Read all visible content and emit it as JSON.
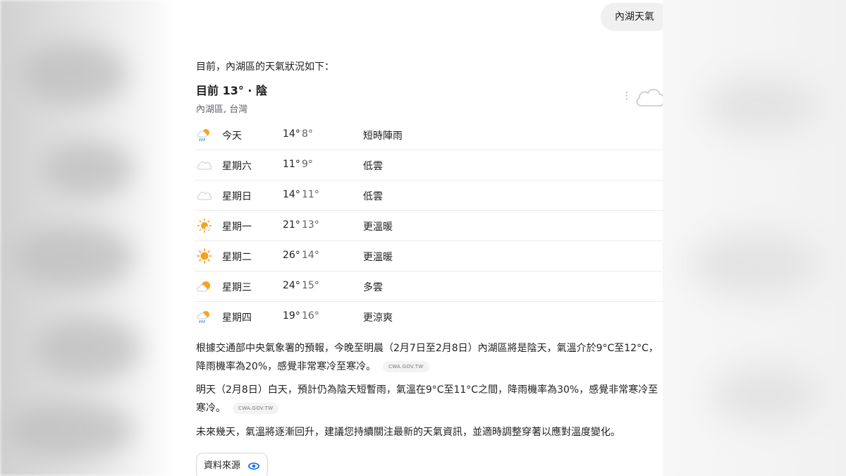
{
  "query": "內湖天氣",
  "intro": "目前，內湖區的天氣狀況如下：",
  "current": {
    "title": "目前 13° · 陰",
    "location": "內湖區, 台灣",
    "icon": "cloud-icon"
  },
  "forecast": [
    {
      "day": "今天",
      "hi": "14°",
      "lo": "8°",
      "cond": "短時陣雨",
      "icon": "sun-rain-icon"
    },
    {
      "day": "星期六",
      "hi": "11°",
      "lo": "9°",
      "cond": "低雲",
      "icon": "cloud-icon"
    },
    {
      "day": "星期日",
      "hi": "14°",
      "lo": "11°",
      "cond": "低雲",
      "icon": "cloud-icon"
    },
    {
      "day": "星期一",
      "hi": "21°",
      "lo": "13°",
      "cond": "更溫暖",
      "icon": "sun-haze-icon"
    },
    {
      "day": "星期二",
      "hi": "26°",
      "lo": "14°",
      "cond": "更溫暖",
      "icon": "sun-icon"
    },
    {
      "day": "星期三",
      "hi": "24°",
      "lo": "15°",
      "cond": "多雲",
      "icon": "partly-cloudy-icon"
    },
    {
      "day": "星期四",
      "hi": "19°",
      "lo": "16°",
      "cond": "更涼爽",
      "icon": "sun-rain-icon"
    }
  ],
  "paragraphs": [
    {
      "text": "根據交通部中央氣象署的預報，今晚至明晨（2月7日至2月8日）內湖區將是陰天，氣溫介於9°C至12°C，降雨機率為20%，感覺非常寒冷至寒冷。",
      "source": "CWA.GOV.TW"
    },
    {
      "text": "明天（2月8日）白天，預計仍為陰天短暫雨，氣溫在9°C至11°C之間，降雨機率為30%，感覺非常寒冷至寒冷。",
      "source": "CWA.GOV.TW"
    },
    {
      "text": "未來幾天，氣溫將逐漸回升，建議您持續關注最新的天氣資訊，並適時調整穿著以應對溫度變化。"
    }
  ],
  "sources_button": "資料來源",
  "colors": {
    "sun": "#f7a21b",
    "cloud": "#c9cdd2",
    "rain": "#4a90d9",
    "eye": "#1a73e8"
  }
}
